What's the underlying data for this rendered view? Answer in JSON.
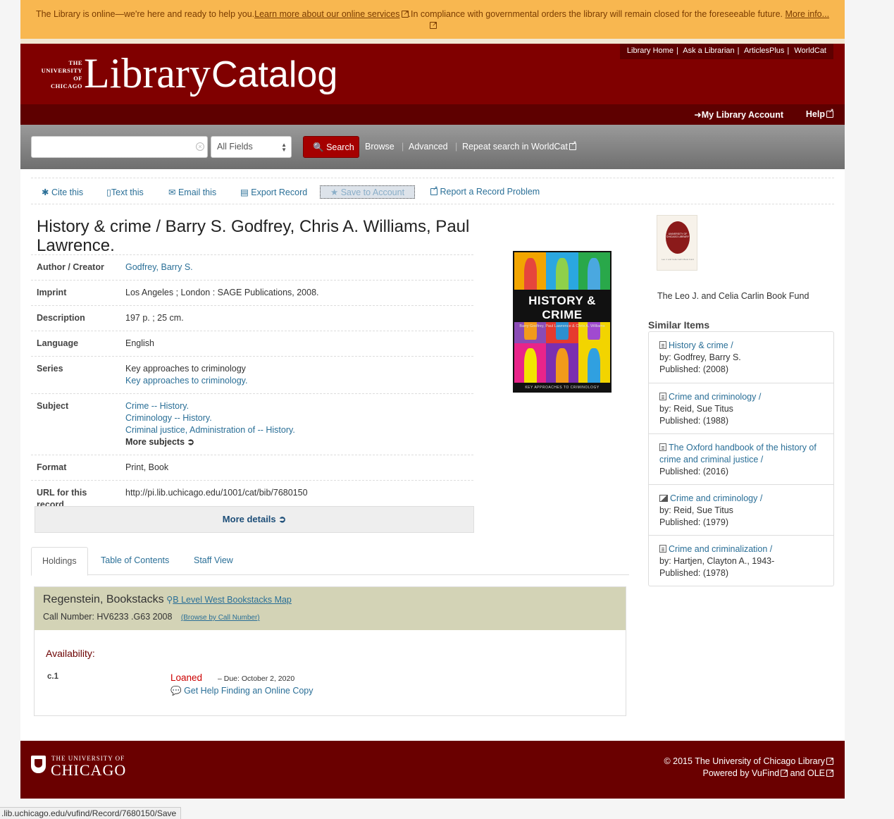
{
  "alert": {
    "text1": "The Library is online—we're here and ready to help you.",
    "link1": "Learn more about our online services",
    "text2": ".In compliance with governmental orders the library will remain closed for the foreseeable future.",
    "link2": "More info..."
  },
  "header": {
    "logo_small_lines": [
      "THE",
      "UNIVERSITY",
      "OF",
      "CHICAGO"
    ],
    "logo_big": "Library",
    "logo_catalog": "Catalog",
    "top_links": [
      "Library Home",
      "Ask a Librarian",
      "ArticlesPlus",
      "WorldCat"
    ],
    "account": "My Library Account",
    "help": "Help"
  },
  "search": {
    "input_value": "",
    "field_select": "All Fields",
    "search_button": "Search",
    "browse": "Browse",
    "advanced": "Advanced",
    "worldcat": "Repeat search in WorldCat"
  },
  "toolbar": {
    "cite": "Cite this",
    "text": "Text this",
    "email": "Email this",
    "export": "Export Record",
    "save": "Save to Account",
    "report": "Report a Record Problem"
  },
  "record": {
    "title": "History & crime / Barry S. Godfrey, Chris A. Williams, Paul Lawrence.",
    "author_label": "Author / Creator",
    "author": "Godfrey, Barry S.",
    "imprint_label": "Imprint",
    "imprint": "Los Angeles ; London : SAGE Publications, 2008.",
    "description_label": "Description",
    "description": "197 p. ; 25 cm.",
    "language_label": "Language",
    "language": "English",
    "series_label": "Series",
    "series_text": "Key approaches to criminology",
    "series_link": "Key approaches to criminology.",
    "subject_label": "Subject",
    "subjects": [
      "Crime -- History.",
      "Criminology -- History.",
      "Criminal justice, Administration of -- History."
    ],
    "more_subjects": "More subjects",
    "format_label": "Format",
    "format": "Print, Book",
    "url_label": "URL for this record",
    "url": "http://pi.lib.uchicago.edu/1001/cat/bib/7680150",
    "more_details": "More details"
  },
  "cover": {
    "title": "HISTORY & CRIME",
    "authors": "Barry Godfrey, Paul Lawrence & Chris A. Williams",
    "series": "KEY APPROACHES TO CRIMINOLOGY",
    "tile_colors": [
      "#f2a500",
      "#2aa7e0",
      "#29a84a",
      "#8a4bb5",
      "#e63a2e",
      "#f2d400",
      "#e8248a",
      "#7b2fb0",
      "#f2d400"
    ],
    "figure_colors": [
      "#e6463c",
      "#8fd04a",
      "#4aa8e0",
      "#f29a1a",
      "#2d8fd0",
      "#a04ad0",
      "#f2e400",
      "#f29a1a",
      "#30a0e0"
    ]
  },
  "bookplate": {
    "seal_text": "UNIVERSITY OF CHICAGO LIBRARY",
    "plate_text": "Leo J. and Celia Carlin Book Fund",
    "fund_name": "The Leo J. and Celia Carlin Book Fund"
  },
  "similar": {
    "heading": "Similar Items",
    "items": [
      {
        "icon": "document-icon",
        "title": "History & crime /",
        "by": "by: Godfrey, Barry S.",
        "published": "Published: (2008)"
      },
      {
        "icon": "document-icon",
        "title": "Crime and criminology /",
        "by": "by: Reid, Sue Titus",
        "published": "Published: (1988)"
      },
      {
        "icon": "document-icon",
        "title": "The Oxford handbook of the history of crime and criminal justice /",
        "by": "",
        "published": "Published: (2016)"
      },
      {
        "icon": "image-icon",
        "title": "Crime and criminology /",
        "by": "by: Reid, Sue Titus",
        "published": "Published: (1979)"
      },
      {
        "icon": "document-icon",
        "title": "Crime and criminalization /",
        "by": "by: Hartjen, Clayton A., 1943-",
        "published": "Published: (1978)"
      }
    ]
  },
  "tabs": {
    "holdings": "Holdings",
    "toc": "Table of Contents",
    "staff": "Staff View"
  },
  "holdings": {
    "location": "Regenstein, Bookstacks",
    "map_link": "B Level West Bookstacks Map",
    "call_number": "Call Number: HV6233 .G63 2008",
    "browse_link": "(Browse by Call Number)",
    "availability": "Availability:",
    "copy": "c.1",
    "status": "Loaned",
    "due": "– Due: October 2, 2020",
    "get_help": "Get Help Finding an Online Copy"
  },
  "footer": {
    "univ_small": "THE UNIVERSITY OF",
    "univ_big": "CHICAGO",
    "copyright": "© 2015 The University of Chicago Library",
    "powered_prefix": "Powered by",
    "vufind": "VuFind",
    "and": "and",
    "ole": "OLE"
  },
  "statusbar": ".lib.uchicago.edu/vufind/Record/7680150/Save",
  "colors": {
    "alert_bg": "#f8b750",
    "header_bg": "#800000",
    "search_button": "#a50000",
    "link": "#2a6f97",
    "loaned": "#cc0000",
    "footer_bg": "#6a0000"
  }
}
